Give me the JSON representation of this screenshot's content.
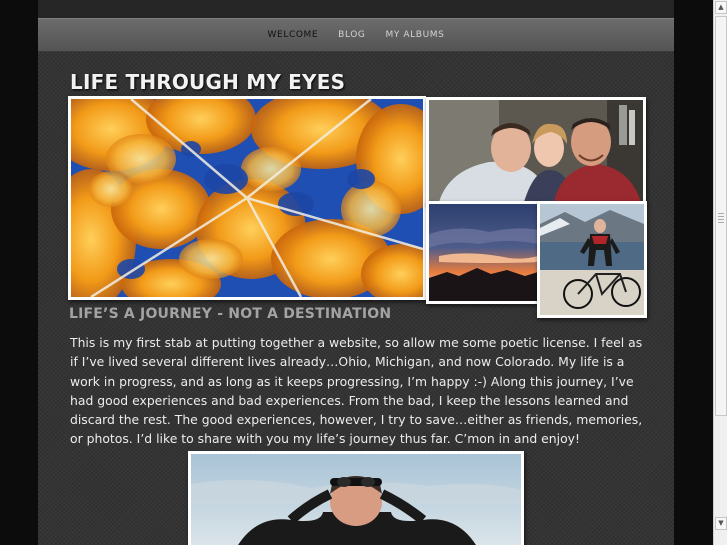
{
  "nav": {
    "items": [
      {
        "label": "WELCOME",
        "active": true
      },
      {
        "label": "BLOG",
        "active": false
      },
      {
        "label": "MY ALBUMS",
        "active": false
      }
    ]
  },
  "site": {
    "title": "LIFE THROUGH MY EYES",
    "tagline": "LIFE’S A JOURNEY - NOT A DESTINATION"
  },
  "intro": {
    "text": "This is my first stab at putting together a website, so allow me some poetic license. I feel as if I’ve lived several different lives already…Ohio, Michigan, and now Colorado. My life is a work in progress, and as long as it keeps progressing, I’m happy :-) Along this journey, I’ve had good experiences and bad experiences. From the bad, I keep the lessons learned and discard the rest. The good experiences, however, I try to save…either as friends, memories, or photos. I’d like to share with you my life’s journey thus far. C’mon in and enjoy!"
  },
  "colors": {
    "page_bg": "#343434",
    "nav_bg": "#606060",
    "title": "#f2f2f2",
    "tagline": "#a3a3a3",
    "body_text": "#ececec"
  },
  "icons": {
    "scroll_up": "up-arrow-icon",
    "scroll_down": "down-arrow-icon"
  }
}
